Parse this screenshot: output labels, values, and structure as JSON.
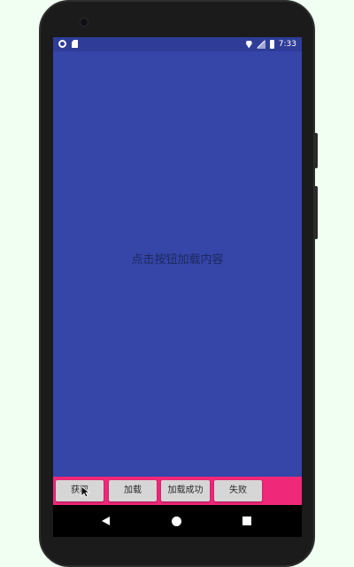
{
  "status_bar": {
    "time": "7:33",
    "left_icons": [
      "notification-icon",
      "sd-card-icon"
    ],
    "right_icons": [
      "location-icon",
      "signal-icon",
      "battery-icon"
    ]
  },
  "main": {
    "message": "点击按钮加载内容",
    "background_color": "#3545a8"
  },
  "button_bar": {
    "background_color": "#f0287a",
    "buttons": [
      {
        "label": "获取"
      },
      {
        "label": "加载"
      },
      {
        "label": "加载成功"
      },
      {
        "label": "失败"
      }
    ]
  },
  "nav_bar": {
    "icons": [
      "back-icon",
      "home-icon",
      "recents-icon"
    ]
  }
}
